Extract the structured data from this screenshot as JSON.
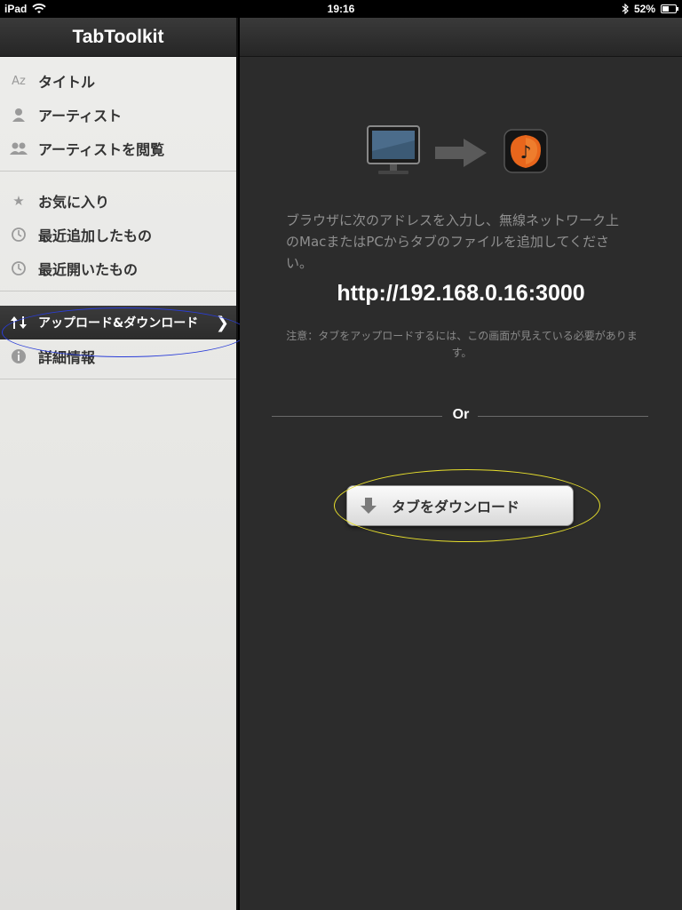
{
  "status_bar": {
    "device": "iPad",
    "time": "19:16",
    "battery_text": "52%",
    "battery_level": 0.52
  },
  "sidebar": {
    "title": "TabToolkit",
    "groups": [
      [
        {
          "label": "タイトル",
          "icon": "az-icon"
        },
        {
          "label": "アーティスト",
          "icon": "person-icon"
        },
        {
          "label": "アーティストを閲覧",
          "icon": "people-icon"
        }
      ],
      [
        {
          "label": "お気に入り",
          "icon": "star-icon"
        },
        {
          "label": "最近追加したもの",
          "icon": "clock-icon"
        },
        {
          "label": "最近開いたもの",
          "icon": "clock-icon"
        }
      ],
      [
        {
          "label": "アップロード&ダウンロード",
          "icon": "up-down-arrows-icon",
          "active": true
        },
        {
          "label": "詳細情報",
          "icon": "info-icon"
        }
      ]
    ]
  },
  "main": {
    "instructions": "ブラウザに次のアドレスを入力し、無線ネットワーク上のMacまたはPCからタブのファイルを追加してください。",
    "url": "http://192.168.0.16:3000",
    "note": "注意：タブをアップロードするには、この画面が見えている必要があります。",
    "or_label": "Or",
    "download_button": "タブをダウンロード"
  },
  "colors": {
    "annotation_blue": "#2a3dd8",
    "annotation_yellow": "#e7df2c",
    "app_icon_orange": "#e8661c"
  }
}
